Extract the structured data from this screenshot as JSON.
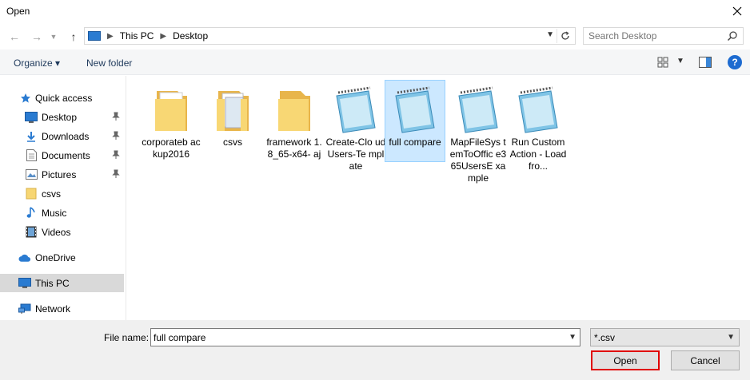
{
  "window": {
    "title": "Open"
  },
  "address": {
    "crumbs": [
      "This PC",
      "Desktop"
    ]
  },
  "search": {
    "placeholder": "Search Desktop"
  },
  "toolbar": {
    "organize_label": "Organize ▾",
    "new_folder_label": "New folder",
    "help_label": "?"
  },
  "nav": {
    "items": [
      {
        "label": "Quick access"
      },
      {
        "label": "Desktop"
      },
      {
        "label": "Downloads"
      },
      {
        "label": "Documents"
      },
      {
        "label": "Pictures"
      },
      {
        "label": "csvs"
      },
      {
        "label": "Music"
      },
      {
        "label": "Videos"
      },
      {
        "label": "OneDrive"
      },
      {
        "label": "This PC"
      },
      {
        "label": "Network"
      }
    ]
  },
  "files": [
    {
      "name": "corporatebackup2016",
      "display": "corporateb ackup2016",
      "kind": "folder"
    },
    {
      "name": "csvs",
      "display": "csvs",
      "kind": "folder-docs"
    },
    {
      "name": "framework1.8_65-x64-aj",
      "display": "framework 1.8_65-x64- aj",
      "kind": "folder"
    },
    {
      "name": "Create-CloudUsers-Template",
      "display": "Create-Clo udUsers-Te mplate",
      "kind": "notepad"
    },
    {
      "name": "full compare",
      "display": "full compare",
      "kind": "notepad"
    },
    {
      "name": "MapFileSystemToOffice365UsersExample",
      "display": "MapFileSys temToOffic e365UsersE xample",
      "kind": "notepad"
    },
    {
      "name": "Run Custom Action - Load from...",
      "display": "Run Custom Action - Load fro...",
      "kind": "notepad"
    }
  ],
  "bottom": {
    "file_name_label": "File name:",
    "file_name_value": "full compare",
    "file_type_value": "*.csv",
    "open_label": "Open",
    "cancel_label": "Cancel"
  },
  "colors": {
    "accent_blue": "#1d6bd0",
    "selection": "#cce8ff",
    "highlight_border": "#e00000"
  }
}
